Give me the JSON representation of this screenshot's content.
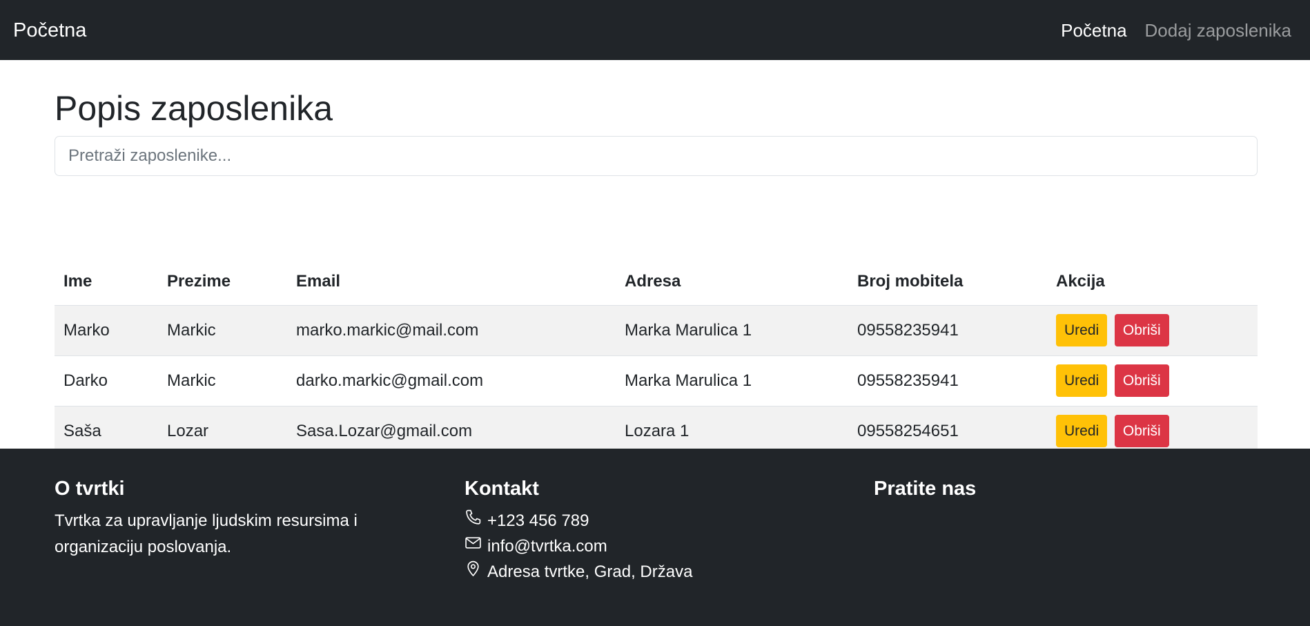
{
  "navbar": {
    "brand": "Početna",
    "links": [
      {
        "label": "Početna"
      },
      {
        "label": "Dodaj zaposlenika"
      }
    ]
  },
  "main": {
    "title": "Popis zaposlenika",
    "search_placeholder": "Pretraži zaposlenike..."
  },
  "table": {
    "headers": [
      "Ime",
      "Prezime",
      "Email",
      "Adresa",
      "Broj mobitela",
      "Akcija"
    ],
    "rows": [
      {
        "ime": "Marko",
        "prezime": "Markic",
        "email": "marko.markic@mail.com",
        "adresa": "Marka Marulica 1",
        "mobitel": "09558235941"
      },
      {
        "ime": "Darko",
        "prezime": "Markic",
        "email": "darko.markic@gmail.com",
        "adresa": "Marka Marulica 1",
        "mobitel": "09558235941"
      },
      {
        "ime": "Saša",
        "prezime": "Lozar",
        "email": "Sasa.Lozar@gmail.com",
        "adresa": "Lozara 1",
        "mobitel": "09558254651"
      }
    ],
    "edit_label": "Uredi",
    "delete_label": "Obriši"
  },
  "footer": {
    "about_title": "O tvrtki",
    "about_text": "Tvrtka za upravljanje ljudskim resursima i organizaciju poslovanja.",
    "contact_title": "Kontakt",
    "phone": "+123 456 789",
    "email": "info@tvrtka.com",
    "address": "Adresa tvrtke, Grad, Država",
    "follow_title": "Pratite nas"
  },
  "colors": {
    "dark": "#212529",
    "warning": "#ffc107",
    "danger": "#dc3545"
  }
}
